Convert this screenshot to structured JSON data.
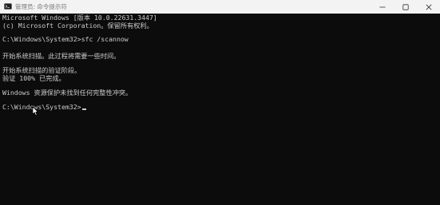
{
  "window": {
    "title": "管理员: 命令提示符",
    "app_icon": "cmd-icon",
    "controls": {
      "minimize_icon": "minimize-icon",
      "maximize_icon": "maximize-icon",
      "close_icon": "close-icon"
    }
  },
  "console": {
    "lines": [
      "Microsoft Windows [版本 10.0.22631.3447]",
      "(c) Microsoft Corporation。保留所有权利。",
      "C:\\Windows\\System32>sfc /scannow",
      "开始系统扫描。此过程将需要一些时间。",
      "开始系统扫描的验证阶段。",
      "验证 100% 已完成。",
      "Windows 资源保护未找到任何完整性冲突。",
      "C:\\Windows\\System32>"
    ],
    "colors": {
      "background": "#0c0c0c",
      "text": "#cccccc"
    }
  }
}
